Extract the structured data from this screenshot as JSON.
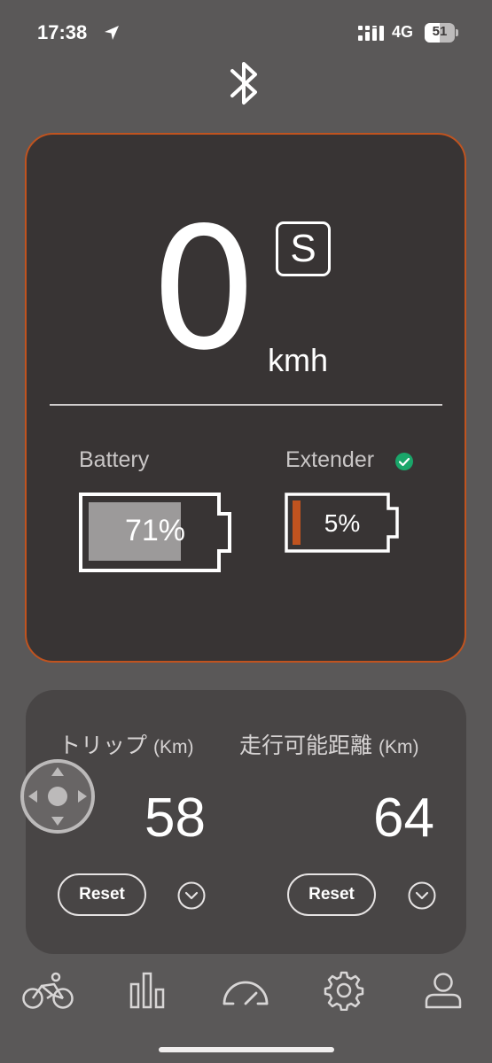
{
  "status_bar": {
    "time": "17:38",
    "network": "4G",
    "battery_level": "51",
    "battery_fraction": 0.51
  },
  "colors": {
    "background": "#5a5858",
    "card": "#383434",
    "card_border": "#c0531f",
    "trip_card": "#484545",
    "extender_fill": "#c0531f",
    "battery_fill": "#9c9a9a",
    "check_green": "#1aa66a"
  },
  "header": {
    "connection_icon": "bluetooth-icon"
  },
  "speed": {
    "value": "0",
    "mode": "S",
    "unit": "kmh"
  },
  "battery": {
    "label": "Battery",
    "percent_text": "71%",
    "level": 0.71
  },
  "extender": {
    "label": "Extender",
    "percent_text": "5%",
    "level": 0.05,
    "status_icon": "check-circle-icon"
  },
  "trip": {
    "label": "トリップ",
    "unit": "(Km)",
    "value": "58",
    "reset_label": "Reset"
  },
  "range": {
    "label": "走行可能距離",
    "unit": "(Km)",
    "value": "64",
    "reset_label": "Reset"
  },
  "nav": {
    "items": [
      {
        "icon": "bicycle-icon"
      },
      {
        "icon": "bar-chart-icon"
      },
      {
        "icon": "speedometer-icon"
      },
      {
        "icon": "gear-icon"
      },
      {
        "icon": "user-icon"
      }
    ]
  }
}
